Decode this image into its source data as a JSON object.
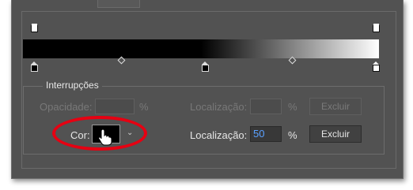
{
  "section": {
    "title": "Interrupções"
  },
  "opacity_row": {
    "opacity_label": "Opacidade:",
    "opacity_value": "",
    "percent": "%",
    "location_label": "Localização:",
    "location_value": "",
    "delete_label": "Excluir"
  },
  "color_row": {
    "color_label": "Cor:",
    "location_label": "Localização:",
    "location_value": "50",
    "percent": "%",
    "delete_label": "Excluir"
  },
  "colors": {
    "ring": "#e60012",
    "accent": "#5aa0ff",
    "panel": "#525252"
  }
}
